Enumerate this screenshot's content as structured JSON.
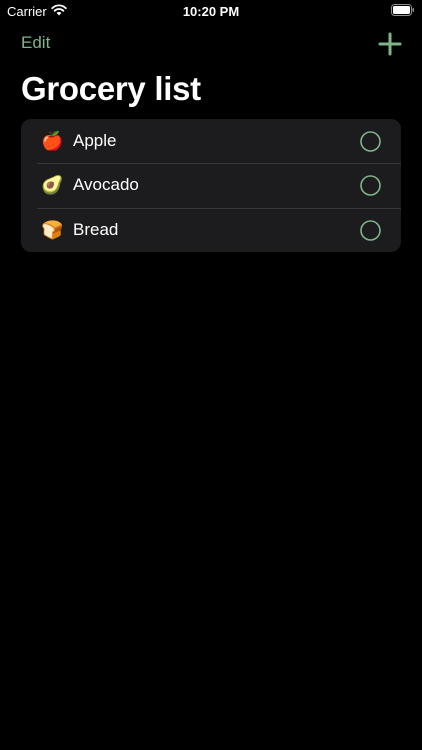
{
  "status_bar": {
    "carrier": "Carrier",
    "time": "10:20 PM",
    "wifi_icon": "wifi-icon",
    "battery_icon": "battery-icon"
  },
  "nav": {
    "edit_label": "Edit",
    "add_icon": "plus-icon"
  },
  "title": "Grocery list",
  "items": [
    {
      "emoji": "🍎",
      "emoji_icon": "apple-icon",
      "label": "Apple",
      "checked": false
    },
    {
      "emoji": "🥑",
      "emoji_icon": "avocado-icon",
      "label": "Avocado",
      "checked": false
    },
    {
      "emoji": "🍞",
      "emoji_icon": "bread-icon",
      "label": "Bread",
      "checked": false
    }
  ],
  "colors": {
    "background": "#000000",
    "card": "#1c1c1e",
    "accent": "#7fb58a",
    "separator": "#38383a",
    "text": "#ffffff"
  }
}
